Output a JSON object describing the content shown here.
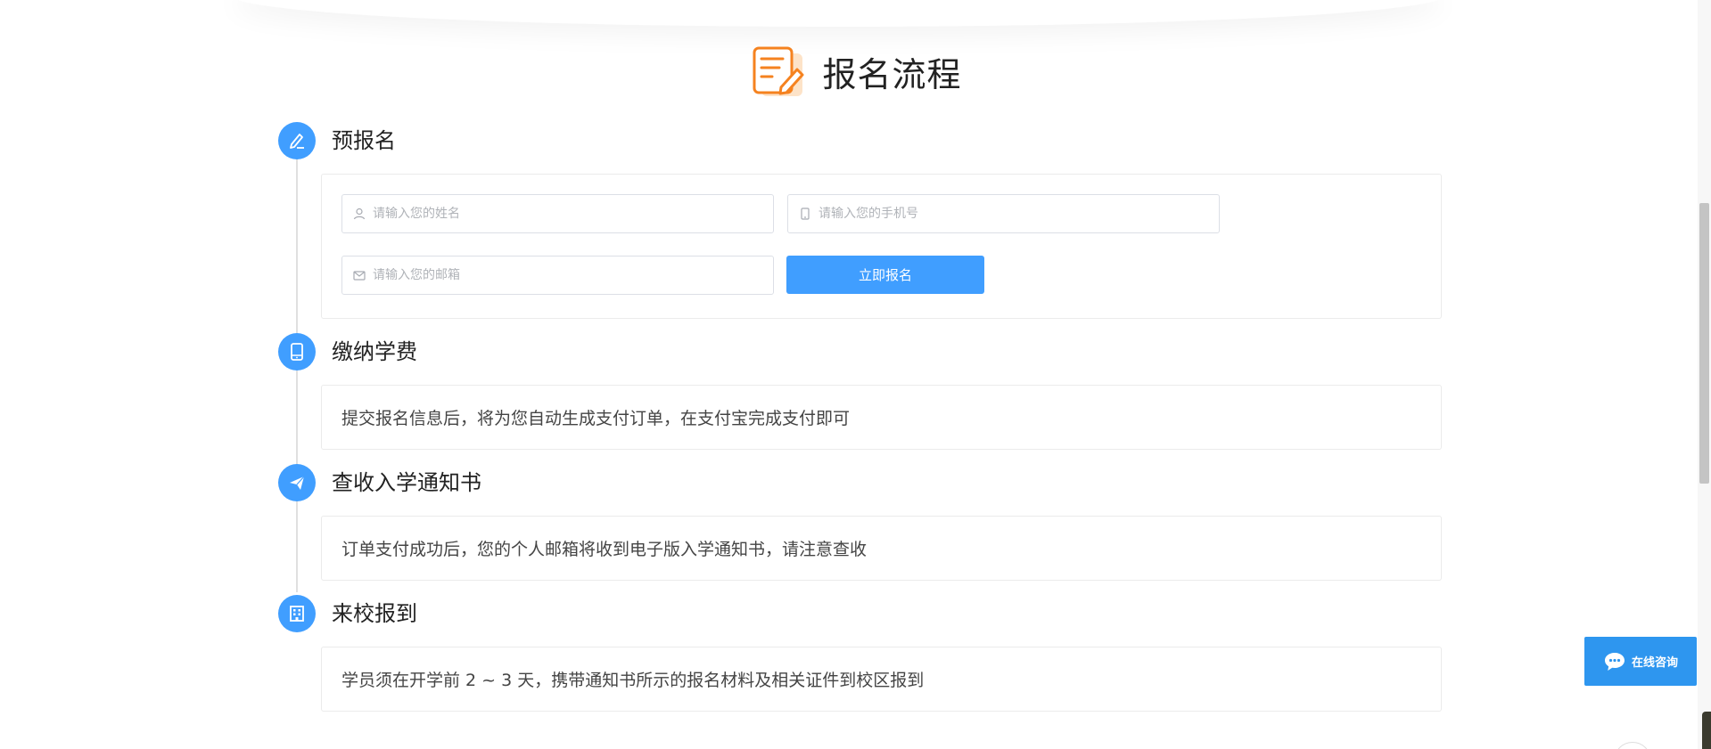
{
  "page": {
    "title": "报名流程"
  },
  "steps": [
    {
      "title": "预报名",
      "icon": "pen-icon"
    },
    {
      "title": "缴纳学费",
      "icon": "tablet-icon",
      "text": "提交报名信息后，将为您自动生成支付订单，在支付宝完成支付即可"
    },
    {
      "title": "查收入学通知书",
      "icon": "paper-plane-icon",
      "text": "订单支付成功后，您的个人邮箱将收到电子版入学通知书，请注意查收"
    },
    {
      "title": "来校报到",
      "icon": "building-icon",
      "text": "学员须在开学前 2 ~ 3 天，携带通知书所示的报名材料及相关证件到校区报到"
    }
  ],
  "form": {
    "name_placeholder": "请输入您的姓名",
    "phone_placeholder": "请输入您的手机号",
    "email_placeholder": "请输入您的邮箱",
    "submit_label": "立即报名"
  },
  "chat": {
    "label": "在线咨询"
  },
  "colors": {
    "accent": "#409eff",
    "header_icon": "#f5821f"
  }
}
